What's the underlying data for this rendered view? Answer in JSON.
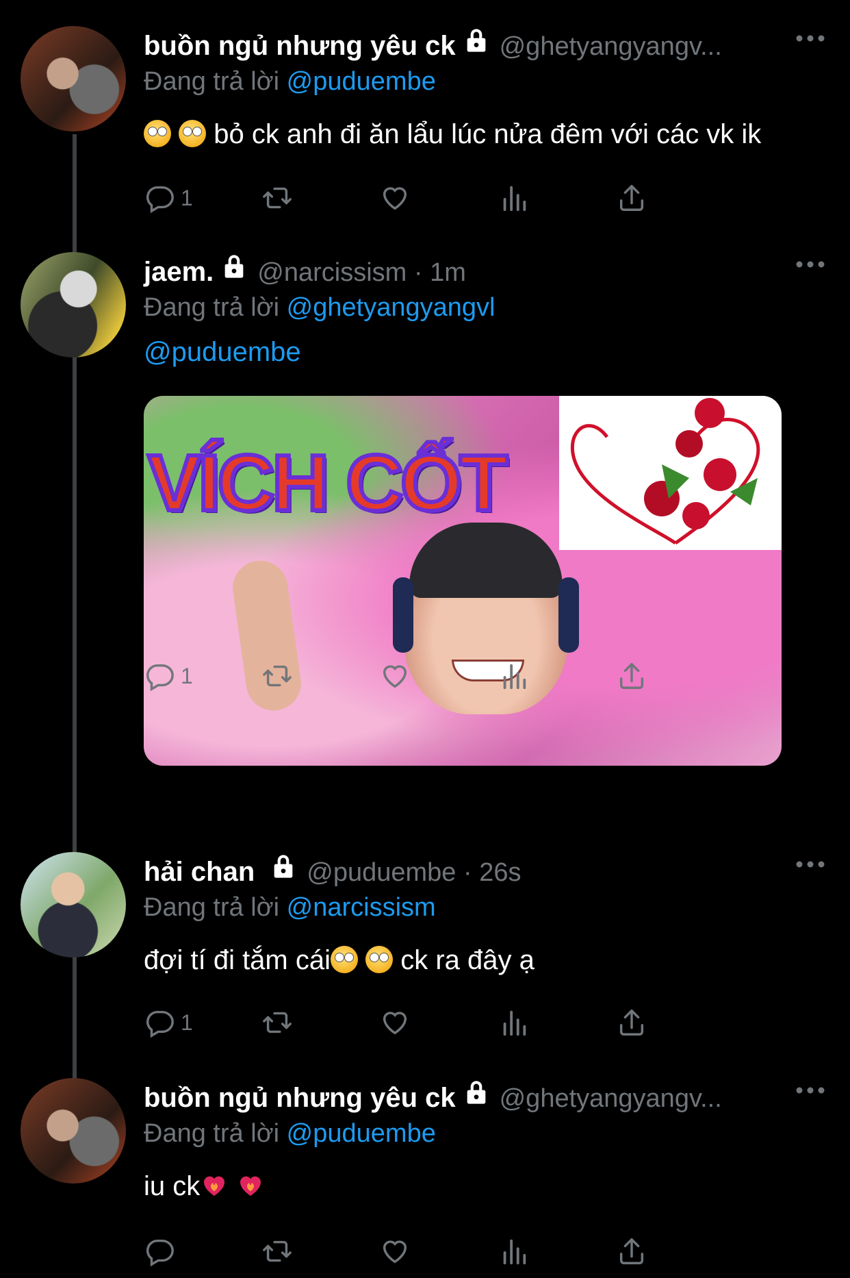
{
  "tweets": [
    {
      "name": "buồn ngủ nhưng yêu ck",
      "handle": "@ghetyangyangv...",
      "reply_prefix": "Đang trả lời ",
      "reply_to": "@puduembe",
      "text": "bỏ ck anh đi ăn lẩu lúc nửa đêm với các vk ik",
      "reply_count": "1"
    },
    {
      "name": "jaem.",
      "handle": "@narcissism · 1m",
      "reply_prefix": "Đang trả lời ",
      "reply_to": "@ghetyangyangvl",
      "text_mention": "@puduembe",
      "media_text": "VÍCH CỐT",
      "reply_count": "1"
    },
    {
      "name": "hải chan",
      "handle": "@puduembe · 26s",
      "reply_prefix": "Đang trả lời ",
      "reply_to": "@narcissism",
      "text_a": "đợi tí đi tắm cái",
      "text_b": " ck ra đây ạ",
      "reply_count": "1"
    },
    {
      "name": "buồn ngủ nhưng yêu ck",
      "handle": "@ghetyangyangv...",
      "reply_prefix": "Đang trả lời ",
      "reply_to": "@puduembe",
      "text": "iu ck",
      "reply_count": ""
    }
  ],
  "icons": [
    "lock-icon",
    "more-icon",
    "reply-icon",
    "retweet-icon",
    "like-icon",
    "views-icon",
    "share-icon",
    "eye-roll-emoji",
    "heart-on-fire-emoji"
  ],
  "colors": {
    "background": "#000000",
    "text": "#ffffff",
    "secondary": "#71767b",
    "link": "#1d9bf0",
    "thread_line": "#3e4144"
  }
}
